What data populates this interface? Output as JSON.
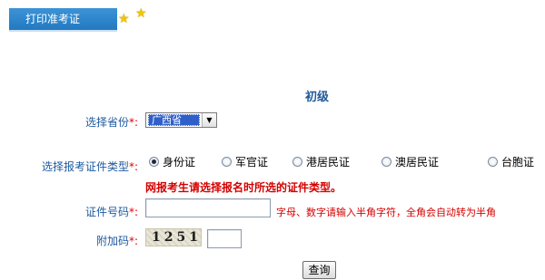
{
  "header": {
    "tab_label": "打印准考证",
    "star_icon": "star-icon"
  },
  "level_title": "初级",
  "province": {
    "label": "选择省份",
    "required_mark": "*:",
    "selected": "广西省"
  },
  "id_type": {
    "label": "选择报考证件类型",
    "required_mark": "*:",
    "options": [
      "身份证",
      "军官证",
      "港居民证",
      "澳居民证",
      "台胞证"
    ],
    "selected": "身份证"
  },
  "warning": "网报考生请选择报名时所选的证件类型。",
  "id_number": {
    "label": "证件号码",
    "required_mark": "*:",
    "value": "",
    "hint": "字母、数字请输入半角字符，全角会自动转为半角"
  },
  "captcha": {
    "label": "附加码",
    "required_mark": "*:",
    "image_text": "1251",
    "value": ""
  },
  "submit_label": "查询"
}
